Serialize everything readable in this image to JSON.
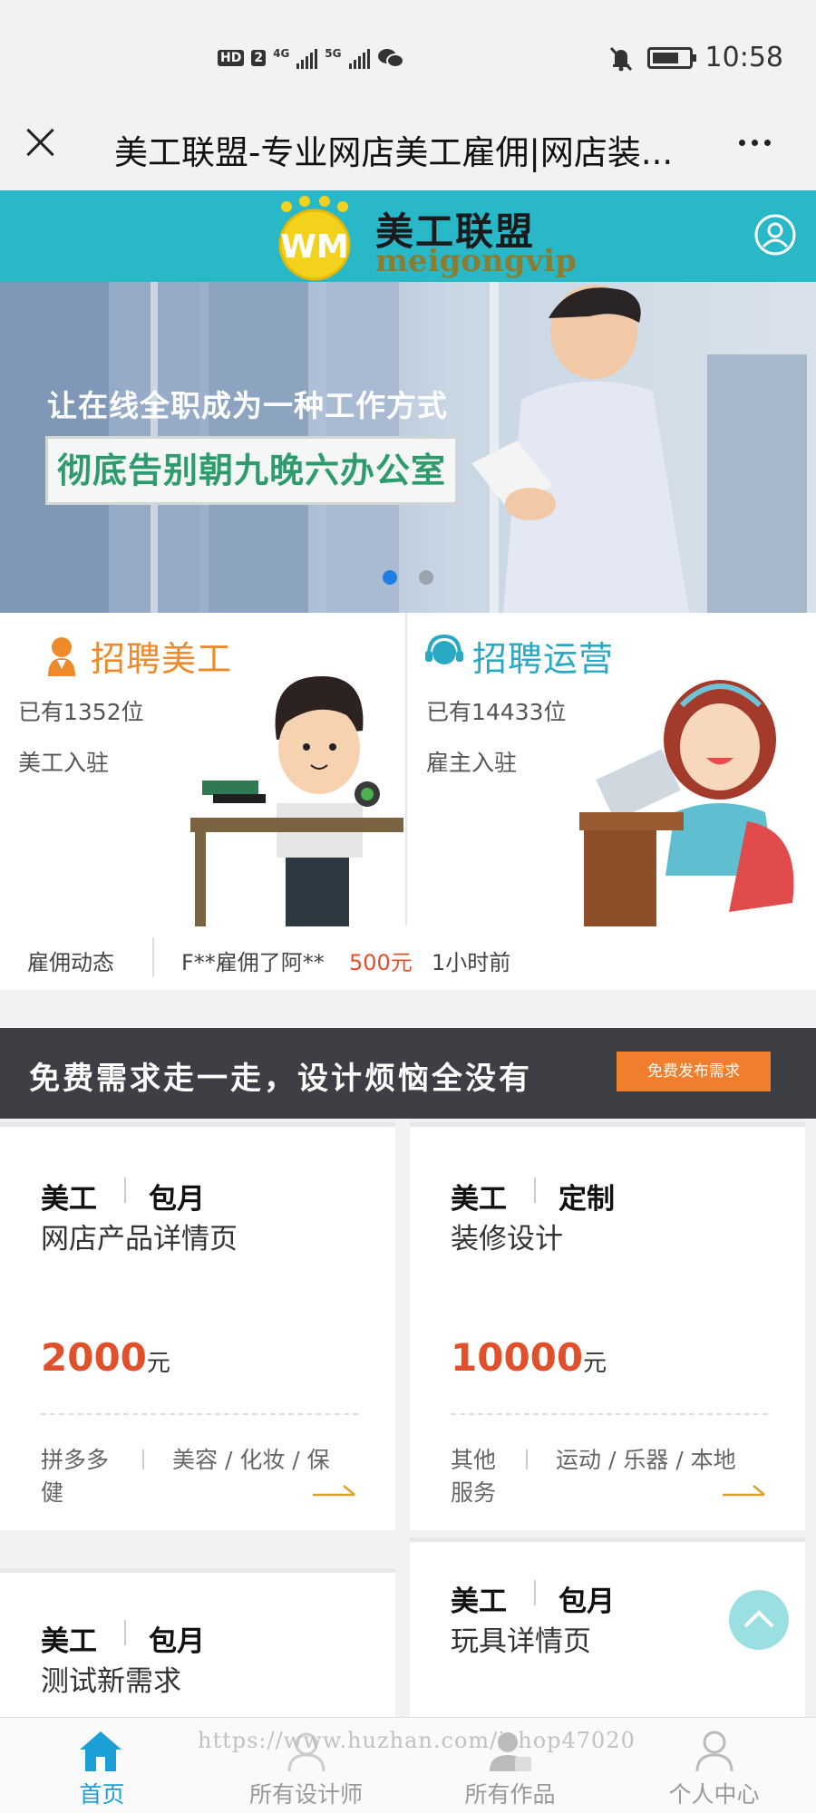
{
  "status_bar": {
    "time": "10:58",
    "hd": "HD",
    "sim": "2",
    "net1": "4G",
    "net2": "5G"
  },
  "title_bar": {
    "title": "美工联盟-专业网店美工雇佣|网店装..."
  },
  "header": {
    "logo_cn": "美工联盟",
    "logo_en": "meigongvip",
    "logo_mark": "WM",
    "accent": "#29b8c8"
  },
  "banner": {
    "line1": "让在线全职成为一种工作方式",
    "line2": "彻底告别朝九晚六办公室",
    "active_slide": 1,
    "slide_count": 2
  },
  "recruit": [
    {
      "title": "招聘美工",
      "count_line": "已有1352位",
      "sub_line": "美工入驻",
      "color": "#ef8a2a"
    },
    {
      "title": "招聘运营",
      "count_line": "已有14433位",
      "sub_line": "雇主入驻",
      "color": "#29a9c4"
    }
  ],
  "ticker": {
    "label": "雇佣动态",
    "text": "F**雇佣了阿**",
    "amount": "500元",
    "time": "1小时前"
  },
  "promo": {
    "text": "免费需求走一走，设计烦恼全没有",
    "button": "免费发布需求"
  },
  "demands": [
    {
      "role": "美工",
      "mode": "包月",
      "name": "网店产品详情页",
      "price": "2000",
      "unit": "元",
      "platform": "拼多多",
      "category": "美容 / 化妆 / 保健"
    },
    {
      "role": "美工",
      "mode": "定制",
      "name": "装修设计",
      "price": "10000",
      "unit": "元",
      "platform": "其他",
      "category": "运动 / 乐器 / 本地服务"
    },
    {
      "role": "美工",
      "mode": "包月",
      "name": "测试新需求"
    },
    {
      "role": "美工",
      "mode": "包月",
      "name": "玩具详情页"
    }
  ],
  "nav": [
    {
      "label": "首页",
      "icon": "home-icon",
      "active": true
    },
    {
      "label": "所有设计师",
      "icon": "designer-icon",
      "active": false
    },
    {
      "label": "所有作品",
      "icon": "works-icon",
      "active": false
    },
    {
      "label": "个人中心",
      "icon": "user-icon",
      "active": false
    }
  ],
  "watermark": "https://www.huzhan.com/ishop47020"
}
